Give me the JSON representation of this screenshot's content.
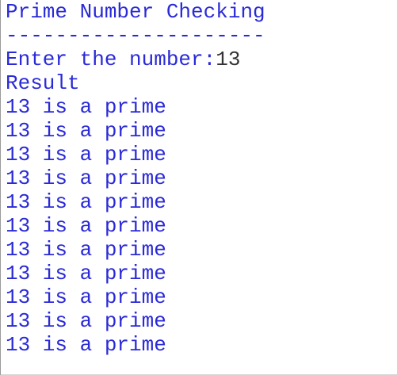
{
  "console": {
    "title": "Prime Number Checking",
    "separator": "---------------------",
    "prompt": "Enter the number:",
    "input_value": "13",
    "result_heading": "Result",
    "results": [
      "13 is a prime",
      "13 is a prime",
      "13 is a prime",
      "13 is a prime",
      "13 is a prime",
      "13 is a prime",
      "13 is a prime",
      "13 is a prime",
      "13 is a prime",
      "13 is a prime",
      "13 is a prime"
    ],
    "colors": {
      "text": "#2a2ad8",
      "input": "#333333",
      "background": "#ffffff"
    }
  }
}
